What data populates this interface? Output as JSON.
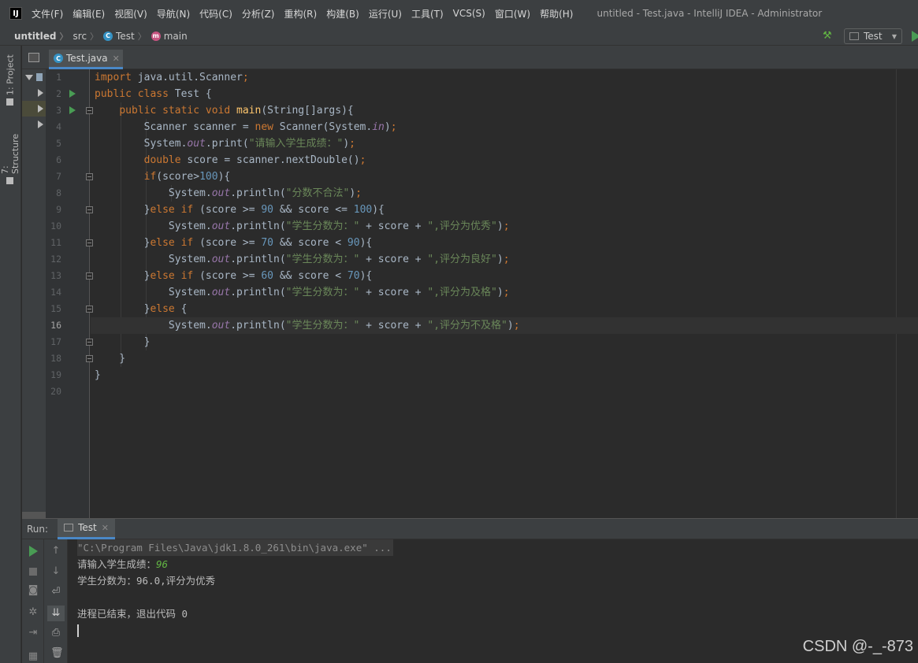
{
  "window": {
    "title": "untitled - Test.java - IntelliJ IDEA - Administrator"
  },
  "menu": {
    "items": [
      "文件(F)",
      "编辑(E)",
      "视图(V)",
      "导航(N)",
      "代码(C)",
      "分析(Z)",
      "重构(R)",
      "构建(B)",
      "运行(U)",
      "工具(T)",
      "VCS(S)",
      "窗口(W)",
      "帮助(H)"
    ]
  },
  "breadcrumb": {
    "project": "untitled",
    "folder": "src",
    "class": "Test",
    "method": "main"
  },
  "toolbar": {
    "run_config": "Test"
  },
  "sidebar": {
    "project_tab": "1: Project",
    "structure_tab": "7: Structure"
  },
  "editor": {
    "tab_label": "Test.java",
    "current_line": 16,
    "line_numbers": [
      "1",
      "2",
      "3",
      "4",
      "5",
      "6",
      "7",
      "8",
      "9",
      "10",
      "11",
      "12",
      "13",
      "14",
      "15",
      "16",
      "17",
      "18",
      "19",
      "20"
    ]
  },
  "run_panel": {
    "label": "Run:",
    "tab_label": "Test",
    "console": {
      "command": "\"C:\\Program Files\\Java\\jdk1.8.0_261\\bin\\java.exe\" ...",
      "prompt": "请输入学生成绩：",
      "input_value": "96",
      "result": "学生分数为：96.0,评分为优秀",
      "exit_message": "进程已结束，退出代码 0"
    }
  },
  "watermark": "CSDN @-_-873",
  "colors": {
    "keyword": "#cc7832",
    "string": "#6a8759",
    "number": "#6897bb",
    "method": "#ffc66d",
    "field": "#9876aa",
    "run_green": "#499c54"
  }
}
